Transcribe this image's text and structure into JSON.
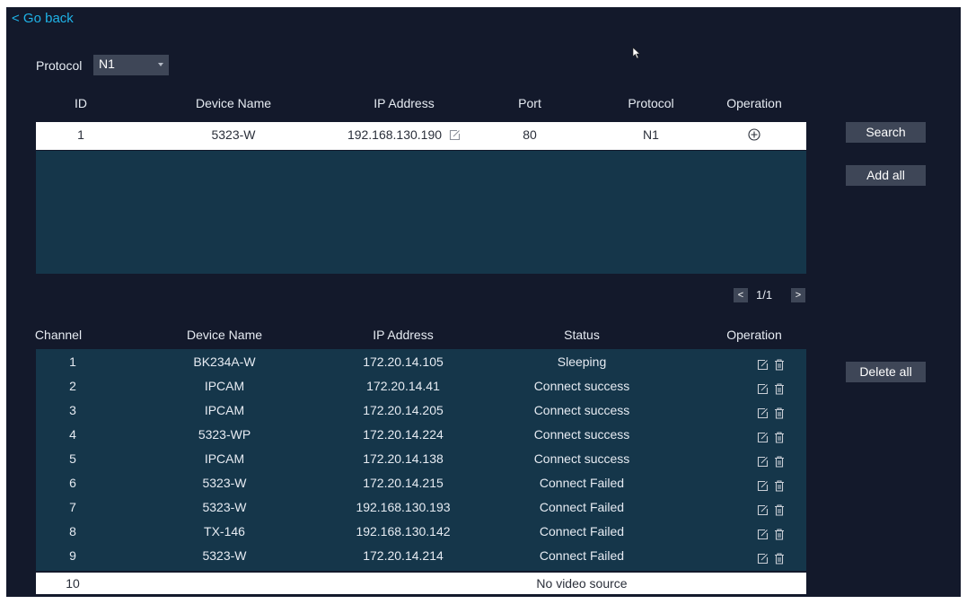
{
  "nav": {
    "go_back": "< Go back"
  },
  "protocol_filter": {
    "label": "Protocol",
    "value": "N1"
  },
  "search_table": {
    "headers": {
      "id": "ID",
      "device_name": "Device Name",
      "ip": "IP Address",
      "port": "Port",
      "protocol": "Protocol",
      "operation": "Operation"
    },
    "rows": [
      {
        "id": "1",
        "device_name": "5323-W",
        "ip": "192.168.130.190",
        "port": "80",
        "protocol": "N1"
      }
    ]
  },
  "actions": {
    "search": "Search",
    "add_all": "Add all",
    "delete_all": "Delete all"
  },
  "pager": {
    "prev": "<",
    "page": "1/1",
    "next": ">"
  },
  "channel_table": {
    "headers": {
      "channel": "Channel",
      "device_name": "Device Name",
      "ip": "IP Address",
      "status": "Status",
      "operation": "Operation"
    },
    "rows": [
      {
        "channel": "1",
        "device_name": "BK234A-W",
        "ip": "172.20.14.105",
        "status": "Sleeping"
      },
      {
        "channel": "2",
        "device_name": "IPCAM",
        "ip": "172.20.14.41",
        "status": "Connect success"
      },
      {
        "channel": "3",
        "device_name": "IPCAM",
        "ip": "172.20.14.205",
        "status": "Connect success"
      },
      {
        "channel": "4",
        "device_name": "5323-WP",
        "ip": "172.20.14.224",
        "status": "Connect success"
      },
      {
        "channel": "5",
        "device_name": "IPCAM",
        "ip": "172.20.14.138",
        "status": "Connect success"
      },
      {
        "channel": "6",
        "device_name": "5323-W",
        "ip": "172.20.14.215",
        "status": "Connect Failed"
      },
      {
        "channel": "7",
        "device_name": "5323-W",
        "ip": "192.168.130.193",
        "status": "Connect Failed"
      },
      {
        "channel": "8",
        "device_name": "TX-146",
        "ip": "192.168.130.142",
        "status": "Connect Failed"
      },
      {
        "channel": "9",
        "device_name": "5323-W",
        "ip": "172.20.14.214",
        "status": "Connect Failed"
      }
    ],
    "empty_row": {
      "channel": "10",
      "status": "No video source"
    }
  },
  "icons": {
    "edit": "edit-icon",
    "delete": "trash-icon",
    "add": "plus-circle-icon",
    "cursor": "mouse-pointer-icon"
  },
  "colors": {
    "background": "#13192b",
    "table_body": "#15364a",
    "accent_link": "#1fb3e8",
    "button": "#3e4657"
  }
}
